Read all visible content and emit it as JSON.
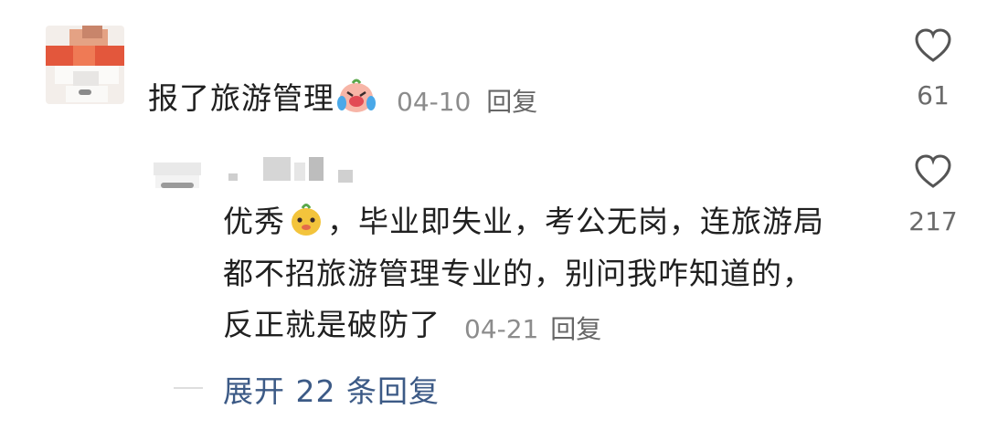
{
  "comments": [
    {
      "text": "报了旅游管理",
      "emoji": "crying-laughing-emoji",
      "date": "04-10",
      "reply_label": "回复",
      "likes": "61"
    }
  ],
  "reply": {
    "line1_a": "优秀",
    "line1_b": "，毕业即失业，考公无岗，连旅游局",
    "line2": "都不招旅游管理专业的，别问我咋知道的，",
    "line3": "反正就是破防了",
    "emoji": "smiling-emoji",
    "date": "04-21",
    "reply_label": "回复",
    "likes": "217"
  },
  "expand": {
    "label": "展开 22 条回复"
  },
  "colors": {
    "text": "#202020",
    "meta": "#8c8c8c",
    "link": "#3c5a86",
    "heart_stroke": "#555555"
  }
}
